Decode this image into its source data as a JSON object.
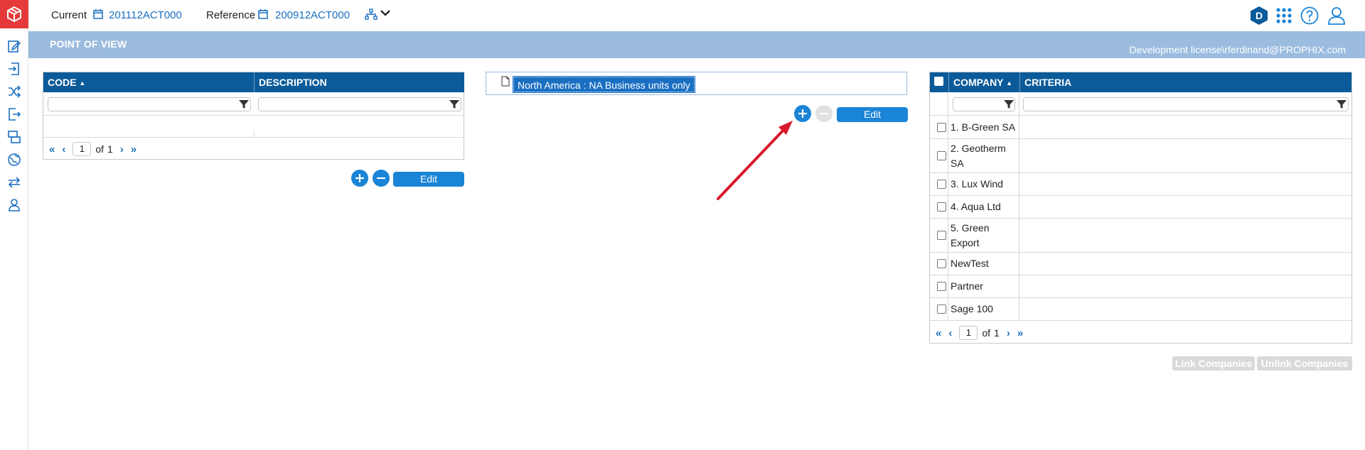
{
  "topbar": {
    "current_label": "Current",
    "current_value": "201112ACT000",
    "reference_label": "Reference",
    "reference_value": "200912ACT000",
    "avatar_letter": "D"
  },
  "band": {
    "title": "POINT OF VIEW",
    "license": "Development license\\rferdinand@PROPHIX.com"
  },
  "left_grid": {
    "columns": [
      "CODE",
      "DESCRIPTION"
    ],
    "sort_indicator": "▲",
    "page": "1",
    "of_label": "of",
    "total_pages": "1",
    "edit_label": "Edit"
  },
  "tree": {
    "node_label": "North America : NA Business units only",
    "edit_label": "Edit"
  },
  "company_grid": {
    "columns": [
      "COMPANY",
      "CRITERIA"
    ],
    "sort_indicator": "▲",
    "rows": [
      {
        "name_line1": "1. B-Green SA",
        "name_line2": ""
      },
      {
        "name_line1": "2. Geotherm",
        "name_line2": "SA"
      },
      {
        "name_line1": "3. Lux Wind",
        "name_line2": ""
      },
      {
        "name_line1": "4. Aqua Ltd",
        "name_line2": ""
      },
      {
        "name_line1": "5. Green",
        "name_line2": "Export"
      },
      {
        "name_line1": "NewTest",
        "name_line2": ""
      },
      {
        "name_line1": "Partner",
        "name_line2": ""
      },
      {
        "name_line1": "Sage 100",
        "name_line2": ""
      }
    ],
    "page": "1",
    "of_label": "of",
    "total_pages": "1",
    "link_label": "Link Companies",
    "unlink_label": "Unlink Companies"
  },
  "colors": {
    "accent": "#1a84d6",
    "header": "#0b5b9a",
    "band": "#9bbcdf",
    "logo": "#e63a3a",
    "annotation": "#d7192c"
  }
}
